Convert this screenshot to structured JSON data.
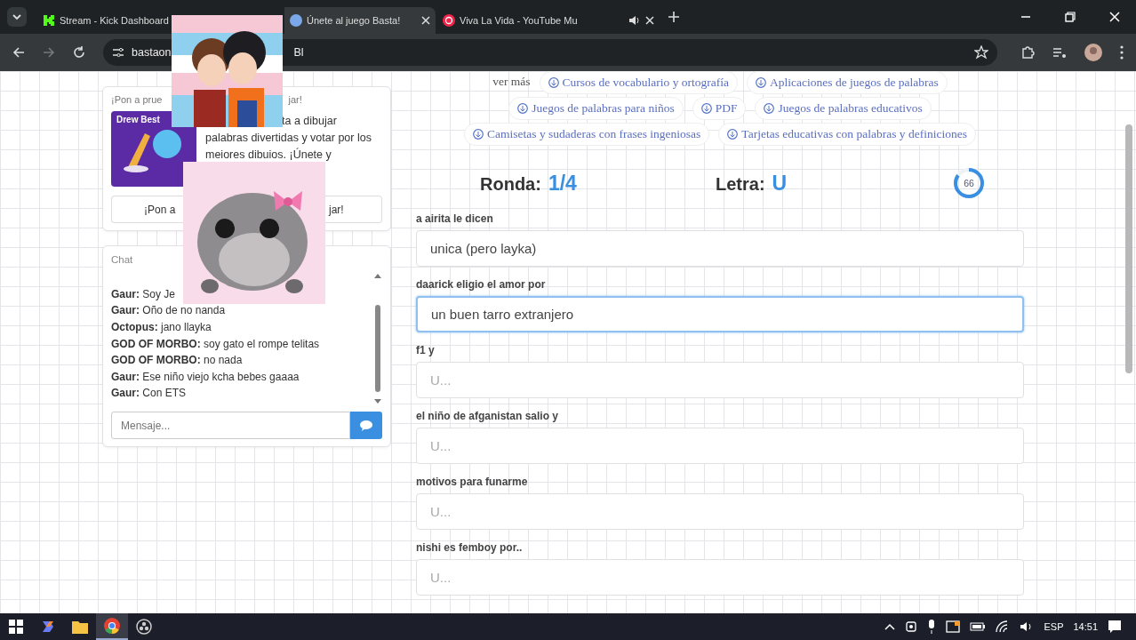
{
  "browser": {
    "tabs": [
      {
        "title": "Stream - Kick Dashboard",
        "selected": false,
        "kind": "kick",
        "audio": false
      },
      {
        "title": "Únete al juego Basta!",
        "selected": true,
        "kind": "site",
        "audio": false
      },
      {
        "title": "Viva La Vida - YouTube Mu",
        "selected": false,
        "kind": "music",
        "audio": true
      }
    ],
    "address": [
      "bastaon",
      "Bl"
    ]
  },
  "promo": {
    "title": [
      "¡Pon a prue",
      "jar!"
    ],
    "image_label": "Drew Best",
    "text": [
      "ta a dibujar",
      "palabras divertidas y votar por los",
      "meiores dibuios. ¡Únete y"
    ],
    "button": [
      "¡Pon a",
      "jar!"
    ]
  },
  "chat": {
    "title": "Chat",
    "messages": [
      {
        "user": "Gaur:",
        "text": "Soy Je"
      },
      {
        "user": "Gaur:",
        "text": "Oño de no nanda"
      },
      {
        "user": "Octopus:",
        "text": "jano llayka"
      },
      {
        "user": "GOD OF MORBO:",
        "text": "soy gato el rompe telitas"
      },
      {
        "user": "GOD OF MORBO:",
        "text": "no nada"
      },
      {
        "user": "Gaur:",
        "text": "Ese niño viejo kcha bebes gaaaa"
      },
      {
        "user": "Gaur:",
        "text": "Con ETS"
      }
    ],
    "placeholder": "Mensaje..."
  },
  "chips": [
    [
      "ver más",
      "Cursos de vocabulario y ortografía",
      "Aplicaciones de juegos de palabras"
    ],
    [
      "Juegos de palabras para niños",
      "PDF",
      "Juegos de palabras educativos"
    ],
    [
      "Camisetas y sudaderas con frases ingeniosas",
      "Tarjetas educativas con palabras y definiciones"
    ]
  ],
  "game": {
    "round_label": "Ronda:",
    "round": "1/4",
    "letter_label": "Letra:",
    "letter": "U",
    "timer": "66",
    "level": 0.85
  },
  "fields": [
    {
      "label": "a airita le dicen",
      "value": "unica (pero layka)",
      "focused": false
    },
    {
      "label": "daarick eligio el amor por",
      "value": "un buen tarro extranjero",
      "focused": true
    },
    {
      "label": "f1 y",
      "placeholder": "U...",
      "focused": false
    },
    {
      "label": "el niño de afganistan salio y",
      "placeholder": "U...",
      "focused": false
    },
    {
      "label": "motivos para funarme",
      "placeholder": "U...",
      "focused": false
    },
    {
      "label": "nishi es femboy por..",
      "placeholder": "U...",
      "focused": false
    }
  ],
  "taskbar": {
    "apps": [
      {
        "kind": "start",
        "selected": false
      },
      {
        "kind": "copilot",
        "selected": false
      },
      {
        "kind": "files",
        "selected": false
      },
      {
        "kind": "chrome",
        "selected": true
      },
      {
        "kind": "obs",
        "selected": false
      }
    ],
    "lang": "ESP",
    "time": "14:51"
  }
}
